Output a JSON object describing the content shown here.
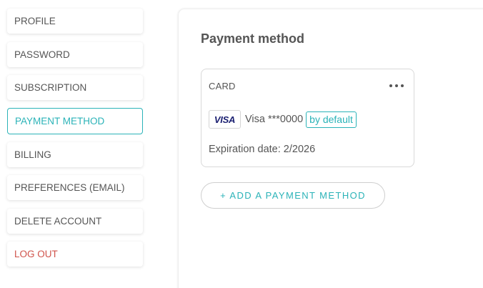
{
  "sidebar": {
    "items": [
      {
        "label": "PROFILE"
      },
      {
        "label": "PASSWORD"
      },
      {
        "label": "SUBSCRIPTION"
      },
      {
        "label": "PAYMENT METHOD",
        "active": true
      },
      {
        "label": "BILLING"
      },
      {
        "label": "PREFERENCES (EMAIL)"
      },
      {
        "label": "DELETE ACCOUNT"
      },
      {
        "label": "LOG OUT"
      }
    ]
  },
  "main": {
    "title": "Payment method",
    "card": {
      "label": "CARD",
      "brand": "VISA",
      "masked_number": "Visa ***0000",
      "default_badge": "by default",
      "expiration": "Expiration date: 2/2026"
    },
    "add_button_label": "+ ADD A PAYMENT METHOD"
  },
  "colors": {
    "accent": "#2bb3b8",
    "danger": "#d0534b",
    "text": "#555555",
    "visa_blue": "#1a1f71"
  },
  "icons": {
    "more": "more-horizontal-icon",
    "visa": "visa-logo-icon"
  }
}
